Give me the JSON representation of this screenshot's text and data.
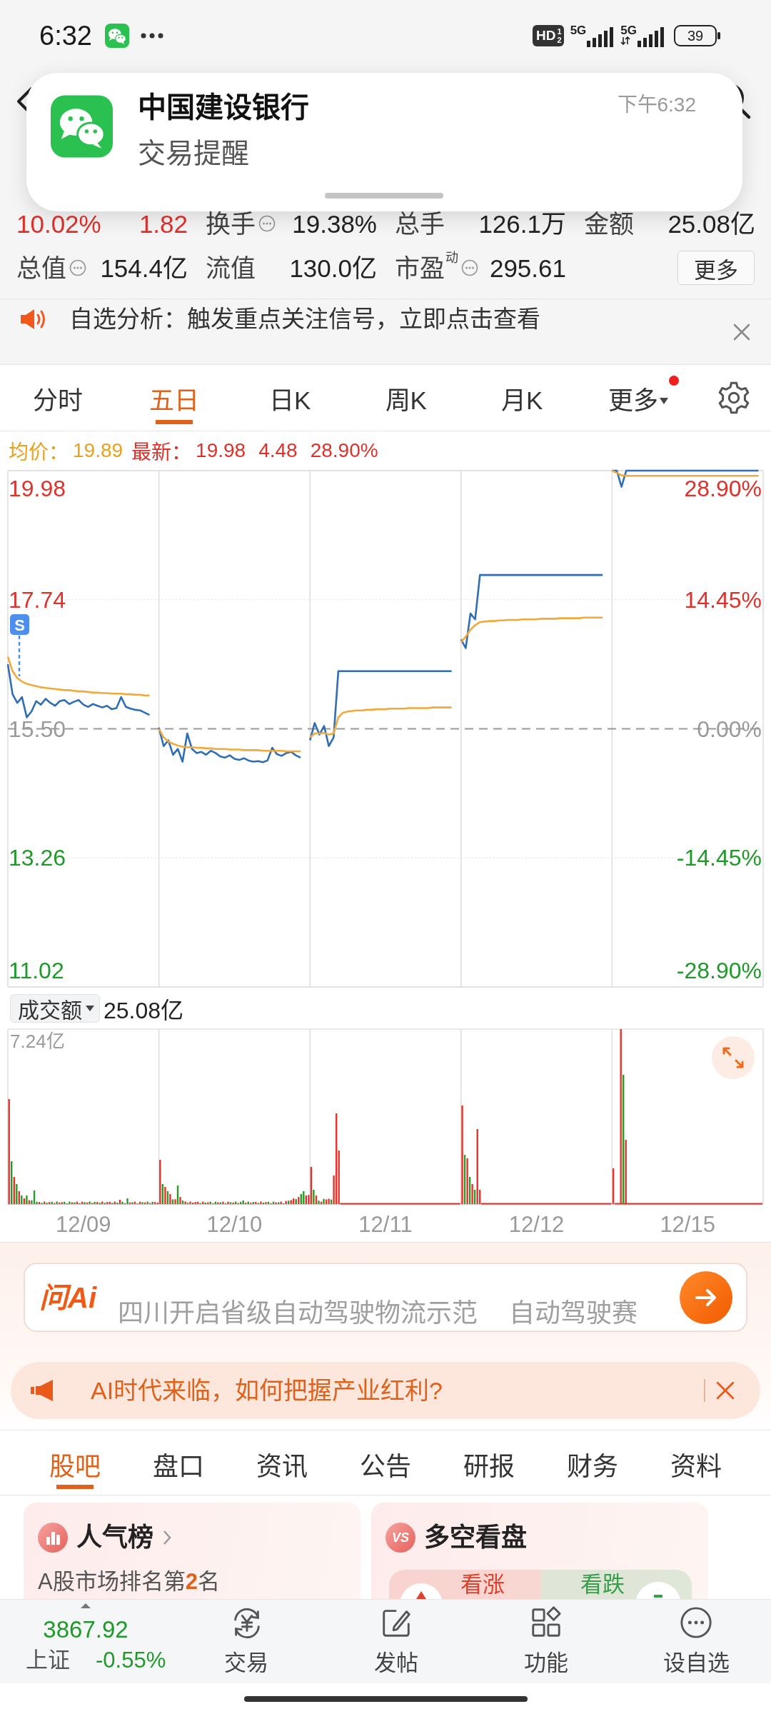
{
  "status_bar": {
    "time": "6:32",
    "hd_badge": {
      "label": "HD",
      "sims": [
        "1",
        "2"
      ]
    },
    "networks": [
      {
        "label": "5G",
        "arrows": false
      },
      {
        "label": "5G",
        "arrows": true
      }
    ],
    "battery": "39"
  },
  "notification": {
    "title": "中国建设银行",
    "body": "交易提醒",
    "time": "下午6:32"
  },
  "quote": {
    "rising": true,
    "change_percent": "10.02%",
    "change": "1.82",
    "stats": [
      {
        "label": "换手",
        "value": "19.38%",
        "info": true
      },
      {
        "label": "总手",
        "value": "126.1万",
        "info": false
      },
      {
        "label": "金额",
        "value": "25.08亿",
        "info": false
      },
      {
        "label": "总值",
        "value": "154.4亿",
        "info": true
      },
      {
        "label": "流值",
        "value": "130.0亿",
        "info": false
      },
      {
        "label": "市盈",
        "sup": "动",
        "value": "295.61",
        "info": true
      }
    ],
    "more_button": "更多"
  },
  "analysis_bar": {
    "text": "自选分析：触发重点关注信号，立即点击查看"
  },
  "period_tabs": [
    {
      "label": "分时",
      "selected": false,
      "dropdown": false,
      "dot": false
    },
    {
      "label": "五日",
      "selected": true,
      "dropdown": false,
      "dot": false
    },
    {
      "label": "日K",
      "selected": false,
      "dropdown": false,
      "dot": false
    },
    {
      "label": "周K",
      "selected": false,
      "dropdown": false,
      "dot": false
    },
    {
      "label": "月K",
      "selected": false,
      "dropdown": false,
      "dot": false
    },
    {
      "label": "更多",
      "selected": false,
      "dropdown": true,
      "dot": true
    }
  ],
  "price_chart": {
    "legend": {
      "average": {
        "label": "均价：",
        "value": "19.89"
      },
      "latest": {
        "label": "最新：",
        "values": [
          "19.98",
          "4.48",
          "28.90%"
        ]
      }
    },
    "signal": {
      "label": "S"
    },
    "right_labels": [
      "28.90%",
      "14.45%",
      "0.00%",
      "-14.45%",
      "-28.90%"
    ],
    "chart_data": {
      "type": "line",
      "categories": [
        null,
        null,
        null,
        null,
        null,
        null,
        null,
        null,
        null,
        null,
        null,
        null,
        null,
        null,
        null,
        null,
        null,
        null,
        null,
        null,
        null,
        null,
        null,
        null,
        null,
        null,
        null,
        null,
        null,
        null,
        null,
        null,
        null,
        null,
        null,
        null,
        null,
        null,
        null,
        null,
        null,
        null,
        null,
        null,
        null,
        null,
        null,
        null,
        null,
        null,
        null,
        null,
        null,
        null,
        null,
        null,
        null,
        null,
        null,
        null,
        null,
        null,
        null,
        null,
        null,
        null,
        null,
        null,
        null,
        null,
        null,
        null,
        null,
        null,
        null,
        null,
        null,
        null,
        null,
        null,
        null,
        null,
        null,
        null,
        null,
        null,
        null,
        null,
        null,
        null,
        null,
        null,
        null,
        null,
        null,
        null,
        null,
        null,
        null,
        null,
        null,
        null,
        null,
        null,
        null,
        null,
        null,
        null,
        null,
        null,
        null,
        null,
        null,
        null,
        null,
        null,
        null,
        null,
        null,
        null,
        null,
        null,
        null,
        null,
        null,
        null,
        null,
        null,
        null,
        null,
        null,
        null,
        null,
        null,
        null,
        null,
        null,
        null,
        null,
        null,
        null,
        null,
        null,
        null,
        null,
        null,
        null,
        null,
        null,
        null,
        null,
        null,
        null,
        null,
        null,
        null,
        null,
        null,
        null,
        null
      ],
      "series": [
        {
          "color": "#2f6db5",
          "values": [
            16.62,
            16.1,
            15.95,
            16.05,
            15.7,
            15.8,
            15.98,
            15.92,
            16.02,
            15.95,
            15.9,
            15.98,
            16,
            15.93,
            15.97,
            16,
            15.92,
            15.88,
            15.93,
            15.9,
            15.87,
            15.9,
            15.84,
            15.86,
            16.05,
            15.88,
            15.85,
            15.83,
            15.82,
            15.78,
            15.74,
            null,
            15.52,
            15.2,
            15.3,
            15.05,
            15.15,
            14.93,
            15.42,
            15.15,
            15.08,
            15.1,
            15.05,
            15.12,
            15.08,
            15.02,
            15,
            15.04,
            14.98,
            14.96,
            14.99,
            14.95,
            14.93,
            14.94,
            14.92,
            14.95,
            15.17,
            15.06,
            15.03,
            15.08,
            15.1,
            15.04,
            15,
            null,
            15.3,
            15.6,
            15.4,
            15.55,
            15.2,
            15.35,
            16.5,
            16.5,
            16.5,
            16.5,
            16.5,
            16.5,
            16.5,
            16.5,
            16.5,
            16.5,
            16.5,
            16.5,
            16.5,
            16.5,
            16.5,
            16.5,
            16.5,
            16.5,
            16.5,
            16.5,
            16.5,
            16.5,
            16.5,
            16.5,
            16.5,
            null,
            17.05,
            16.9,
            17.5,
            17.4,
            18.17,
            18.17,
            18.17,
            18.17,
            18.17,
            18.17,
            18.17,
            18.17,
            18.17,
            18.17,
            18.17,
            18.17,
            18.17,
            18.17,
            18.17,
            18.17,
            18.17,
            18.17,
            18.17,
            18.17,
            18.17,
            18.17,
            18.17,
            18.17,
            18.17,
            18.17,
            18.17,
            null,
            19.98,
            19.98,
            19.7,
            19.98,
            19.98,
            19.98,
            19.98,
            19.98,
            19.98,
            19.98,
            19.98,
            19.98,
            19.98,
            19.98,
            19.98,
            19.98,
            19.98,
            19.98,
            19.98,
            19.98,
            19.98,
            19.98,
            19.98,
            19.98,
            19.98,
            19.98,
            19.98,
            19.98,
            19.98,
            19.98,
            19.98,
            19.98
          ]
        },
        {
          "color": "#f2a93b",
          "values": [
            16.75,
            16.5,
            16.38,
            16.32,
            16.28,
            16.26,
            16.24,
            16.22,
            16.21,
            16.2,
            16.19,
            16.18,
            16.17,
            16.17,
            16.16,
            16.15,
            16.15,
            16.14,
            16.13,
            16.13,
            16.12,
            16.12,
            16.11,
            16.11,
            16.11,
            16.1,
            16.1,
            16.09,
            16.09,
            16.08,
            16.08,
            null,
            15.5,
            15.35,
            15.28,
            15.24,
            15.21,
            15.19,
            15.18,
            15.18,
            15.17,
            15.17,
            15.16,
            15.16,
            15.15,
            15.15,
            15.15,
            15.14,
            15.14,
            15.14,
            15.13,
            15.13,
            15.13,
            15.13,
            15.12,
            15.12,
            15.12,
            15.12,
            15.12,
            15.11,
            15.11,
            15.11,
            15.11,
            null,
            15.35,
            15.42,
            15.42,
            15.43,
            15.4,
            15.42,
            15.7,
            15.78,
            15.8,
            15.81,
            15.82,
            15.82,
            15.83,
            15.83,
            15.84,
            15.84,
            15.84,
            15.85,
            15.85,
            15.85,
            15.85,
            15.86,
            15.86,
            15.86,
            15.86,
            15.86,
            15.87,
            15.87,
            15.87,
            15.87,
            15.87,
            null,
            17,
            17.1,
            17.22,
            17.3,
            17.35,
            17.36,
            17.37,
            17.37,
            17.38,
            17.38,
            17.39,
            17.39,
            17.39,
            17.4,
            17.4,
            17.4,
            17.4,
            17.41,
            17.41,
            17.41,
            17.41,
            17.42,
            17.42,
            17.42,
            17.42,
            17.42,
            17.43,
            17.43,
            17.43,
            17.43,
            17.43,
            null,
            19.98,
            19.94,
            19.9,
            19.89,
            19.89,
            19.89,
            19.89,
            19.89,
            19.89,
            19.89,
            19.89,
            19.89,
            19.89,
            19.89,
            19.89,
            19.89,
            19.89,
            19.89,
            19.89,
            19.89,
            19.89,
            19.89,
            19.89,
            19.89,
            19.89,
            19.89,
            19.89,
            19.89,
            19.89,
            19.89,
            19.89,
            19.89
          ]
        }
      ],
      "ylim": [
        11.02,
        19.98
      ],
      "yticks": [
        {
          "value": 19.98,
          "label": "19.98"
        },
        {
          "value": 17.74,
          "label": "17.74"
        },
        {
          "value": 15.5,
          "label": "15.50"
        },
        {
          "value": 13.26,
          "label": "13.26"
        },
        {
          "value": 11.02,
          "label": "11.02"
        }
      ],
      "ref_lines": [
        {
          "axis": "y",
          "value": 15.5
        }
      ]
    }
  },
  "volume_chart": {
    "selector": "成交额",
    "total": "25.08亿",
    "max_label": "7.24亿",
    "dates": [
      "12/09",
      "12/10",
      "12/11",
      "12/12",
      "12/15"
    ]
  },
  "ai_search": {
    "logo": "问Ai",
    "ticker": [
      "四川开启省级自动驾驶物流示范",
      "自动驾驶赛"
    ]
  },
  "promo_banner": {
    "text": "AI时代来临，如何把握产业红利?"
  },
  "info_tabs": [
    {
      "label": "股吧",
      "selected": true
    },
    {
      "label": "盘口",
      "selected": false
    },
    {
      "label": "资讯",
      "selected": false
    },
    {
      "label": "公告",
      "selected": false
    },
    {
      "label": "研报",
      "selected": false
    },
    {
      "label": "财务",
      "selected": false
    },
    {
      "label": "资料",
      "selected": false
    }
  ],
  "cards": [
    {
      "kind": "ranking",
      "title": "人气榜",
      "subtitle": "A股市场排名第**2**名"
    },
    {
      "kind": "vote",
      "badge": "VS",
      "title": "多空看盘",
      "options": [
        {
          "kind": "rise",
          "label": "看涨",
          "color": "#e0412e"
        },
        {
          "kind": "fall",
          "label": "看跌",
          "color": "#36a04a"
        }
      ]
    }
  ],
  "bottom_nav": {
    "index": {
      "value": "3867.92",
      "name": "上证",
      "change": "-0.55%",
      "rising": false
    },
    "items": [
      {
        "kind": "trade",
        "label": "交易"
      },
      {
        "kind": "post",
        "label": "发帖"
      },
      {
        "kind": "functions",
        "label": "功能"
      },
      {
        "kind": "watch",
        "label": "设自选"
      }
    ]
  }
}
